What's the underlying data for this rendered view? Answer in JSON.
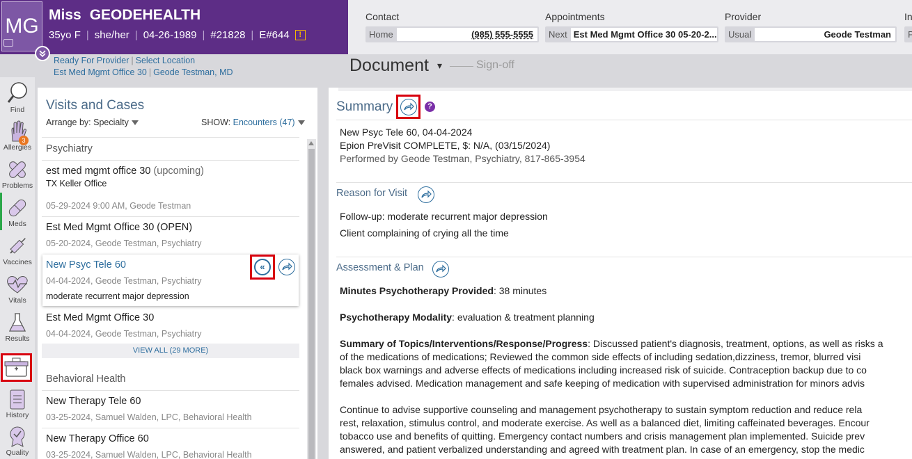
{
  "patient": {
    "initials": "MG",
    "title": "Miss",
    "name": "GEODEHEALTH",
    "age_sex": "35yo F",
    "pronouns": "she/her",
    "dob": "04-26-1989",
    "mrn": "#21828",
    "enc": "E#644",
    "alert": "!"
  },
  "contact": {
    "label": "Contact",
    "key": "Home",
    "value": "(985) 555-5555"
  },
  "appointments": {
    "label": "Appointments",
    "key": "Next",
    "value": "Est Med Mgmt Office 30 05-20-2..."
  },
  "provider": {
    "label": "Provider",
    "key": "Usual",
    "value": "Geode Testman"
  },
  "insurance": {
    "label": "In",
    "key": "P"
  },
  "status": {
    "ready": "Ready For Provider",
    "select_location": "Select Location",
    "location": "Est Med Mgmt Office 30",
    "provider": "Geode Testman, MD"
  },
  "document": {
    "title": "Document",
    "caret": "▾",
    "signoff": "Sign-off"
  },
  "iconbar": {
    "find": "Find",
    "allergies": "Allergies",
    "allergies_count": "3",
    "problems": "Problems",
    "meds": "Meds",
    "vaccines": "Vaccines",
    "vitals": "Vitals",
    "results": "Results",
    "history": "History",
    "quality": "Quality"
  },
  "visits": {
    "title": "Visits and Cases",
    "arrange_label": "Arrange by:",
    "arrange_value": "Specialty",
    "show_label": "SHOW:",
    "show_value": "Encounters (47)",
    "sections": [
      {
        "name": "Psychiatry",
        "items": [
          {
            "title": "est med mgmt office 30",
            "status": "(upcoming)",
            "place": "TX Keller Office",
            "sub": "05-29-2024 9:00 AM, Geode Testman"
          },
          {
            "title": "Est Med Mgmt Office 30 (OPEN)",
            "sub": "05-20-2024, Geode Testman, Psychiatry"
          },
          {
            "title": "New Psyc Tele 60",
            "sub": "04-04-2024, Geode Testman, Psychiatry",
            "dx": "moderate recurrent major depression"
          },
          {
            "title": "Est Med Mgmt Office 30",
            "sub": "04-04-2024, Geode Testman, Psychiatry"
          }
        ],
        "view_all": "VIEW ALL (29 MORE)"
      },
      {
        "name": "Behavioral Health",
        "items": [
          {
            "title": "New Therapy Tele 60",
            "sub": "03-25-2024, Samuel Walden, LPC, Behavioral Health"
          },
          {
            "title": "New Therapy Office 60",
            "sub": "03-25-2024, Samuel Walden, LPC, Behavioral Health"
          }
        ]
      }
    ]
  },
  "summary": {
    "title": "Summary",
    "help": "?",
    "line1": "New Psyc Tele 60, 04-04-2024",
    "line2": "Epion PreVisit COMPLETE, $: N/A, (03/15/2024)",
    "line3": "Performed by Geode Testman, Psychiatry, 817-865-3954"
  },
  "reason": {
    "title": "Reason for Visit",
    "line1": "Follow-up: moderate recurrent major depression",
    "line2": "Client complaining of crying all the time"
  },
  "assessment": {
    "title": "Assessment & Plan",
    "minutes_label": "Minutes Psychotherapy Provided",
    "minutes_value": ": 38 minutes",
    "modality_label": "Psychotherapy Modality",
    "modality_value": ": evaluation & treatment planning",
    "topics_label": "Summary of Topics/Interventions/Response/Progress",
    "topics_lines": [
      ": Discussed patient's diagnosis, treatment, options, as well as risks a",
      "of the medications of medications; Reviewed the common side effects of including sedation,dizziness, tremor, blurred visi",
      "black box warnings and adverse effects of medications including increased risk of suicide. Contraception backup due to co",
      "females advised. Medication management and safe keeping of medication with supervised administration for minors advis"
    ],
    "continue_lines": [
      "Continue to advise supportive counseling and management psychotherapy to sustain symptom reduction and reduce rela",
      "rest, relaxation, stimulus control, and moderate exercise. As well as a balanced diet, limiting caffeinated beverages. Encour",
      "tobacco use and benefits of quitting. Emergency contact numbers and crisis management plan implemented. Suicide prev",
      "answered, and patient verbalized understanding and agreed with treatment plan. In case of an emergency, stop the medic"
    ]
  }
}
